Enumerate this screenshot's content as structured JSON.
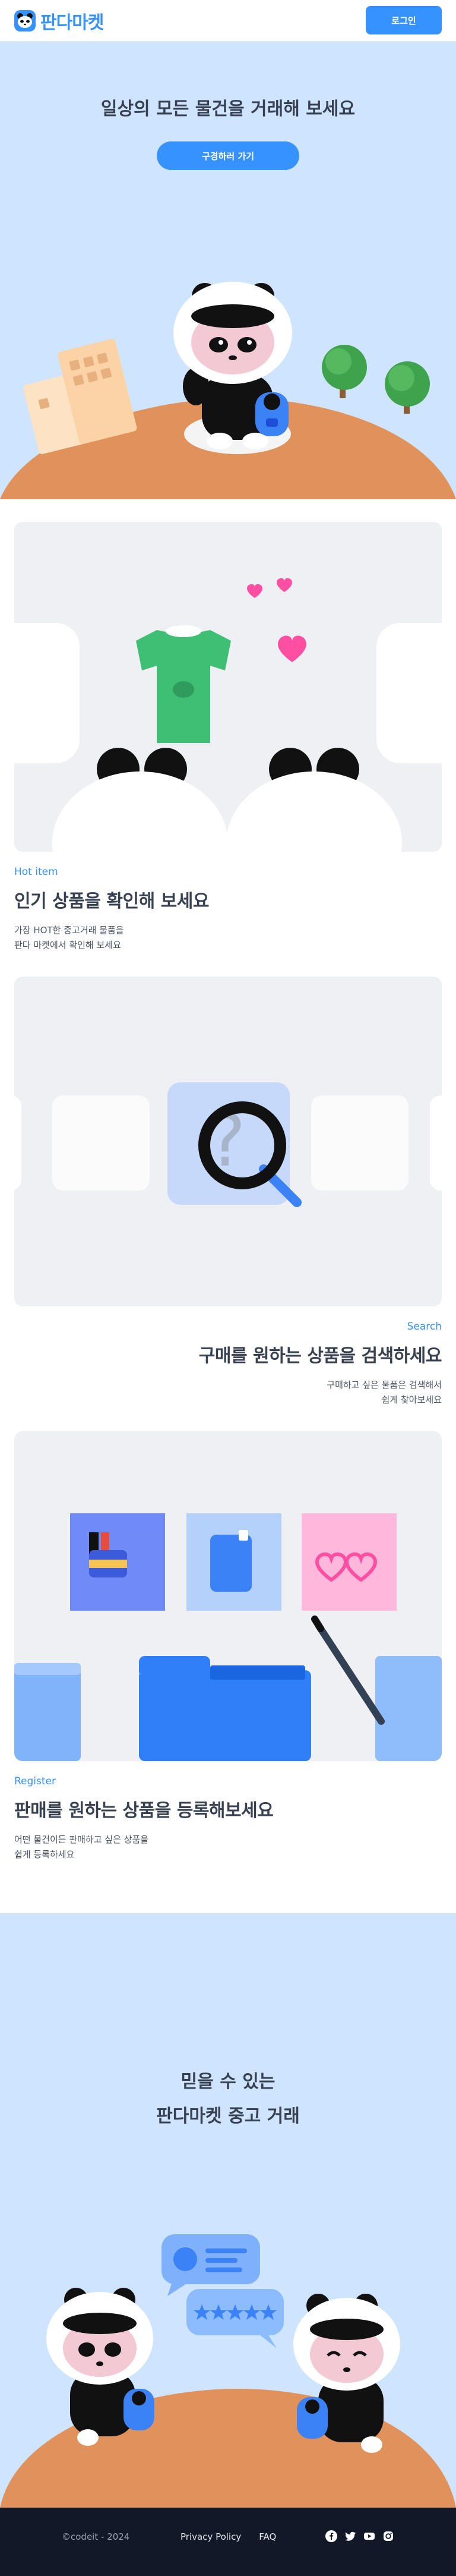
{
  "header": {
    "logo_text": "판다마켓",
    "login_label": "로그인"
  },
  "hero": {
    "title": "일상의 모든 물건을 거래해 보세요",
    "cta_label": "구경하러 가기"
  },
  "sections": [
    {
      "tag": "Hot item",
      "title": "인기 상품을 확인해 보세요",
      "desc": "가장 HOT한 중고거래 물품을\n판다 마켓에서 확인해 보세요"
    },
    {
      "tag": "Search",
      "title": "구매를 원하는 상품을 검색하세요",
      "desc": "구매하고 싶은 물품은 검색해서\n쉽게 찾아보세요"
    },
    {
      "tag": "Register",
      "title": "판매를 원하는 상품을 등록해보세요",
      "desc": "어떤 물건이든 판매하고 싶은 상품을\n쉽게 등록하세요"
    }
  ],
  "bottom": {
    "line1": "믿을 수 있는",
    "line2": "판다마켓 중고 거래"
  },
  "footer": {
    "copyright": "©codeit - 2024",
    "privacy": "Privacy Policy",
    "faq": "FAQ",
    "social_icons": [
      "facebook-icon",
      "twitter-icon",
      "youtube-icon",
      "instagram-icon"
    ]
  },
  "colors": {
    "brand": "#3692ff",
    "hero_bg": "#cfe5ff",
    "footer_bg": "#111827",
    "ground": "#e0925a"
  }
}
